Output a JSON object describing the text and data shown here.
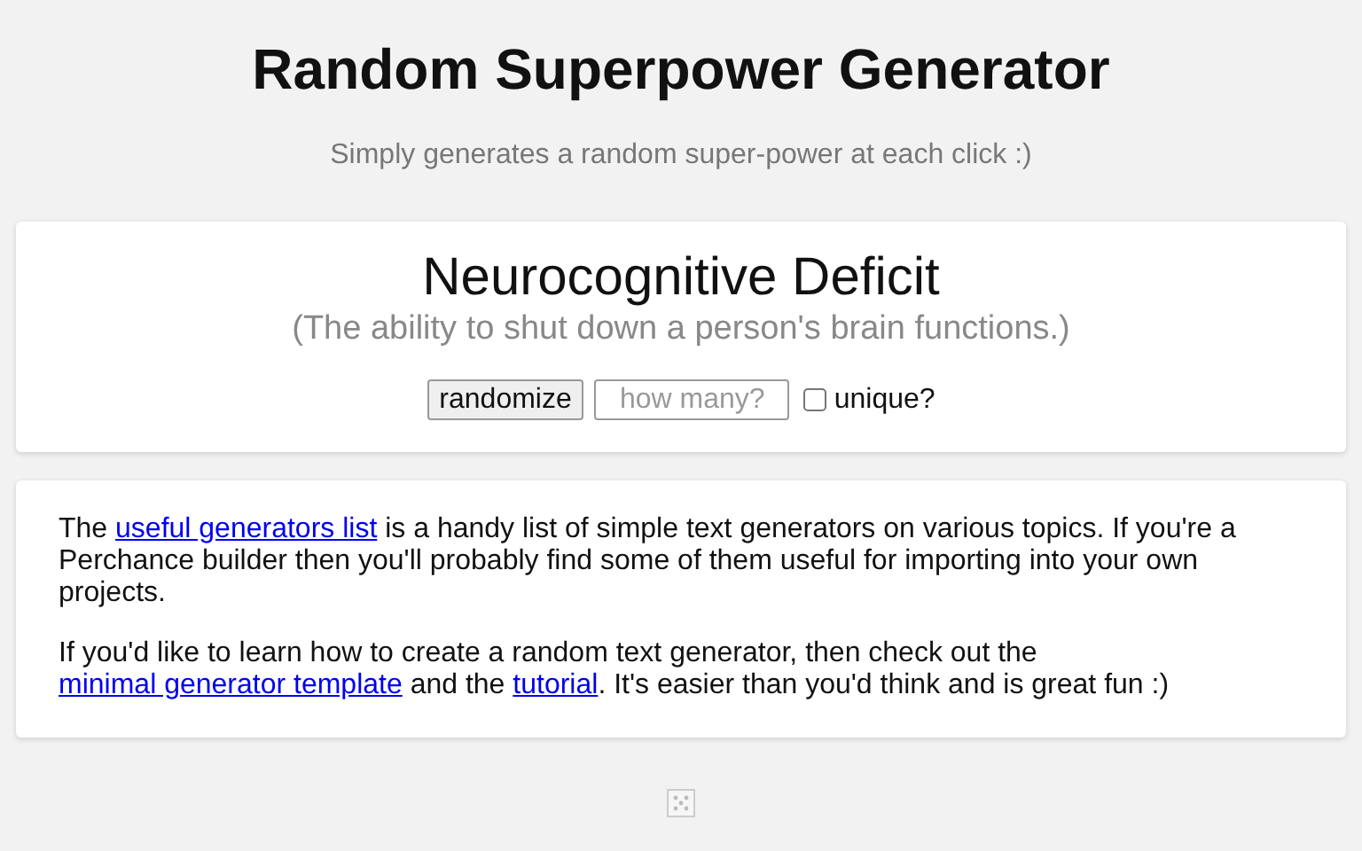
{
  "title": "Random Superpower Generator",
  "subtitle": "Simply generates a random super-power at each click :)",
  "result": {
    "name": "Neurocognitive Deficit",
    "description": "(The ability to shut down a person's brain functions.)"
  },
  "controls": {
    "button": "randomize",
    "count_field": {
      "placeholder": "how many?"
    },
    "unique": {
      "label": "unique?",
      "checked": false
    }
  },
  "info": [
    [
      {
        "kind": "text",
        "text": "The "
      },
      {
        "kind": "link",
        "text": "useful generators list"
      },
      {
        "kind": "text",
        "text": " is a handy list of simple text generators on various topics. If you're a Perchance builder then you'll probably find some of them useful for importing into your own projects."
      }
    ],
    [
      {
        "kind": "text",
        "text": "If you'd like to learn how to create a random text generator, then check out the "
      },
      {
        "kind": "link",
        "text": "minimal generator template"
      },
      {
        "kind": "text",
        "text": " and the "
      },
      {
        "kind": "link",
        "text": "tutorial"
      },
      {
        "kind": "text",
        "text": ". It's easier than you'd think and is great fun :)"
      }
    ]
  ]
}
